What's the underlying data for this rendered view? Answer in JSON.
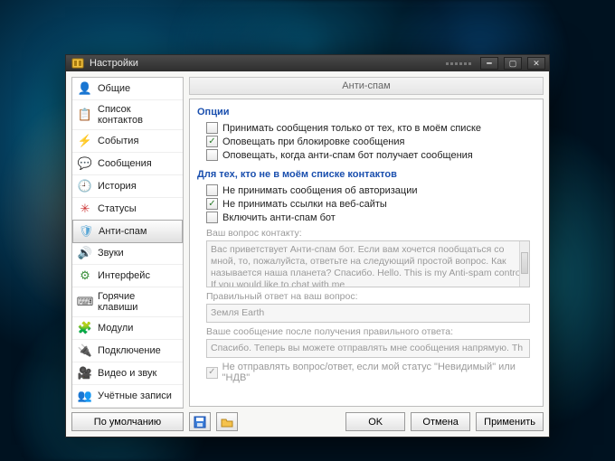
{
  "window": {
    "title": "Настройки"
  },
  "sidebar": {
    "default_btn": "По умолчанию",
    "items": [
      {
        "label": "Общие",
        "icon": "👤",
        "color": "#c9a227"
      },
      {
        "label": "Список контактов",
        "icon": "📋",
        "color": "#c33"
      },
      {
        "label": "События",
        "icon": "⚡",
        "color": "#c9a227"
      },
      {
        "label": "Сообщения",
        "icon": "💬",
        "color": "#3a8f3a"
      },
      {
        "label": "История",
        "icon": "🕘",
        "color": "#2a6bc4"
      },
      {
        "label": "Статусы",
        "icon": "✳",
        "color": "#c33"
      },
      {
        "label": "Анти-спам",
        "icon": "🛡",
        "color": "#5aa7d6",
        "selected": true
      },
      {
        "label": "Звуки",
        "icon": "🔊",
        "color": "#2a6bc4"
      },
      {
        "label": "Интерфейс",
        "icon": "⚙",
        "color": "#3a8f3a"
      },
      {
        "label": "Горячие клавиши",
        "icon": "⌨",
        "color": "#555"
      },
      {
        "label": "Модули",
        "icon": "🧩",
        "color": "#2a6bc4"
      },
      {
        "label": "Подключение",
        "icon": "🔌",
        "color": "#c33"
      },
      {
        "label": "Видео и звук",
        "icon": "🎥",
        "color": "#555"
      },
      {
        "label": "Учётные записи",
        "icon": "👥",
        "color": "#3a8f3a"
      }
    ]
  },
  "panel": {
    "title": "Анти-спам",
    "section_options": "Опции",
    "opt_only_from_list": {
      "label": "Принимать сообщения только от тех, кто в моём списке",
      "checked": false
    },
    "opt_notify_block": {
      "label": "Оповещать при блокировке сообщения",
      "checked": true
    },
    "opt_notify_bot": {
      "label": "Оповещать, когда анти-спам бот получает сообщения",
      "checked": false
    },
    "section_notinlist": "Для тех, кто не в моём списке контактов",
    "opt_no_auth": {
      "label": "Не принимать сообщения об авторизации",
      "checked": false
    },
    "opt_no_links": {
      "label": "Не принимать ссылки на веб-сайты",
      "checked": true
    },
    "opt_enable_bot": {
      "label": "Включить анти-спам бот",
      "checked": false
    },
    "question_label": "Ваш вопрос контакту:",
    "question_text": "Вас приветствует Анти-спам бот. Если вам хочется пообщаться со мной, то, пожалуйста, ответьте на следующий простой вопрос. Как называется наша планета? Спасибо.\n\nHello. This is my Anti-spam control. If you would like to chat with me",
    "answer_label": "Правильный ответ на ваш вопрос:",
    "answer_text": "Земля Earth",
    "after_label": "Ваше сообщение после получения правильного ответа:",
    "after_text": "Спасибо. Теперь вы можете отправлять мне сообщения напрямую. Th",
    "opt_not_if_invisible": {
      "label": "Не отправлять вопрос/ответ, если мой статус \"Невидимый\" или \"НДВ\"",
      "checked": true
    }
  },
  "buttons": {
    "ok": "OK",
    "cancel": "Отмена",
    "apply": "Применить"
  }
}
